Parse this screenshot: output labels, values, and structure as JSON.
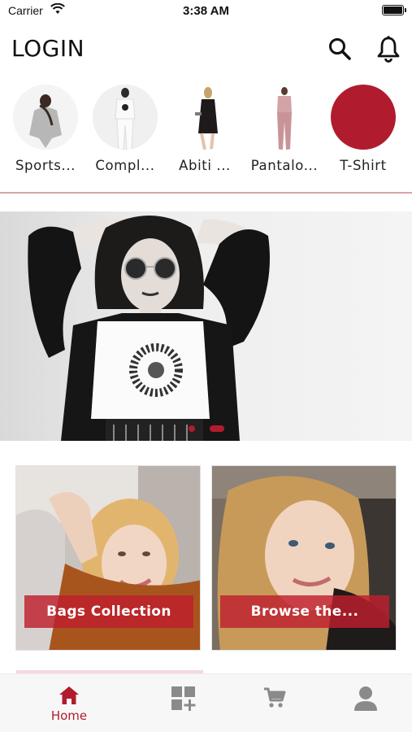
{
  "status_bar": {
    "carrier": "Carrier",
    "time": "3:38 AM"
  },
  "header": {
    "title": "LOGIN"
  },
  "categories": [
    {
      "label": "Sports...",
      "icon": "hoodie-model-photo"
    },
    {
      "label": "Compl...",
      "icon": "white-set-model-photo"
    },
    {
      "label": "Abiti ...",
      "icon": "black-dress-model-photo"
    },
    {
      "label": "Pantalo...",
      "icon": "pink-pants-model-photo"
    },
    {
      "label": "T-Shirt",
      "icon": "red-circle"
    }
  ],
  "banner": {
    "image": "woman-leather-jacket-sunglasses-photo",
    "pages": 2,
    "active_page": 1
  },
  "cards": [
    {
      "label": "Bags Collection",
      "image": "woman-with-bag-photo"
    },
    {
      "label": "Browse the...",
      "image": "smiling-woman-photo"
    }
  ],
  "tab_bar": {
    "items": [
      {
        "label": "Home",
        "icon": "home-icon",
        "active": true
      },
      {
        "label": "",
        "icon": "grid-add-icon",
        "active": false
      },
      {
        "label": "",
        "icon": "cart-icon",
        "active": false
      },
      {
        "label": "",
        "icon": "person-icon",
        "active": false
      }
    ]
  },
  "colors": {
    "accent": "#b01c2e",
    "divider": "#d9a3a8",
    "icon_inactive": "#8a8a8a"
  }
}
